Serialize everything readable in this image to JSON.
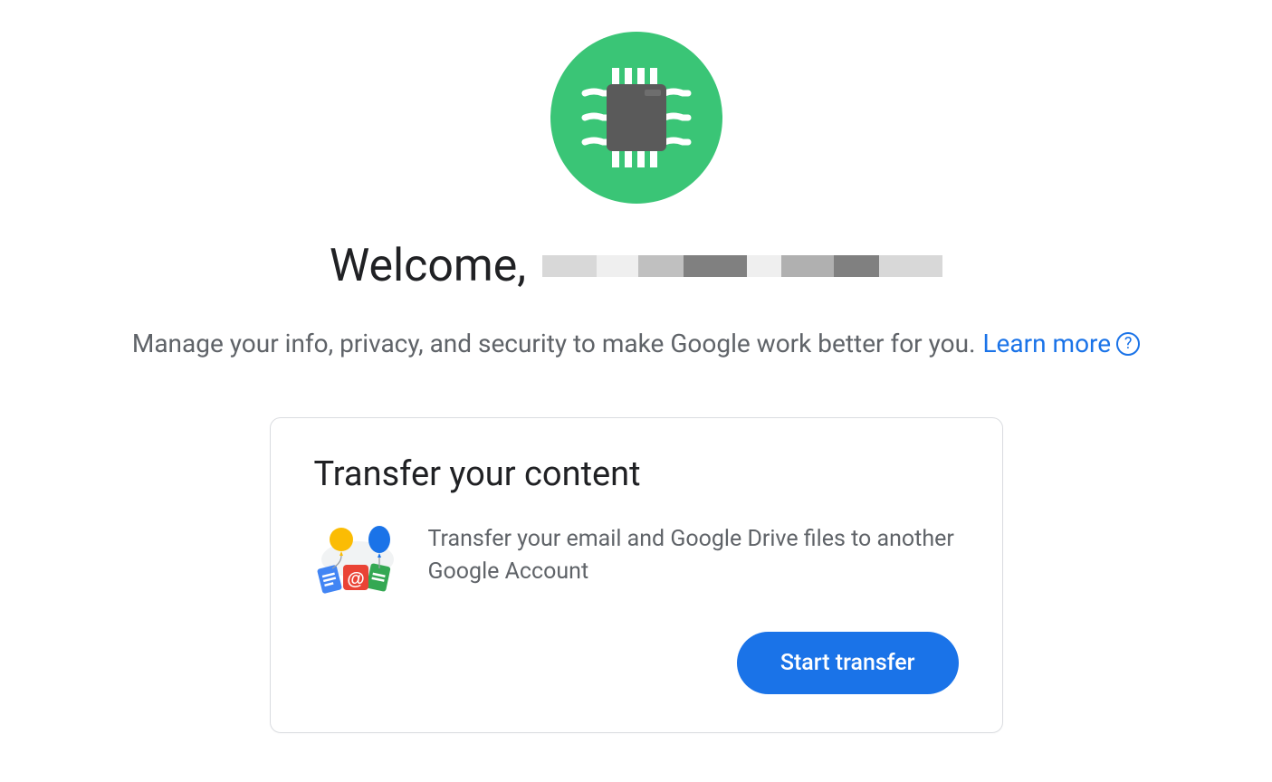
{
  "header": {
    "welcome_prefix": "Welcome,",
    "name_redacted": true
  },
  "subtitle": {
    "text": "Manage your info, privacy, and security to make Google work better for you.",
    "learn_more_label": "Learn more"
  },
  "card": {
    "title": "Transfer your content",
    "description": "Transfer your email and Google Drive files to another Google Account",
    "button_label": "Start transfer"
  },
  "colors": {
    "avatar_bg": "#3ac576",
    "primary_button": "#1a73e8",
    "link": "#1a73e8",
    "text_primary": "#202124",
    "text_secondary": "#5f6368"
  },
  "icons": {
    "avatar": "chip-icon",
    "help": "help-circle-icon",
    "card_illustration": "balloons-files-icon"
  }
}
